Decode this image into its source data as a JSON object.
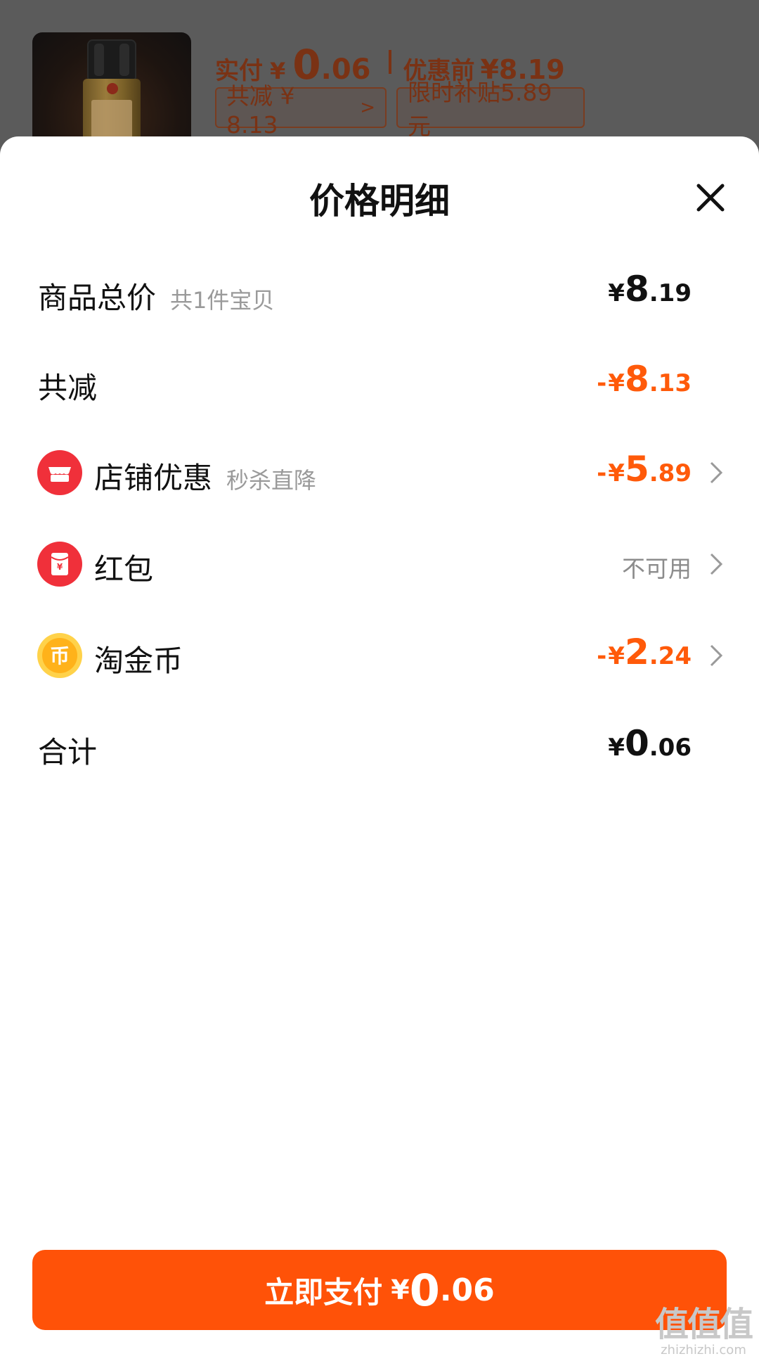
{
  "header": {
    "actual_pay_label": "实付",
    "actual_pay_currency": "¥",
    "actual_pay_int": "0",
    "actual_pay_dec": ".06",
    "before_discount_label": "优惠前",
    "before_discount_value": "¥8.19",
    "total_reduction_tag": "共减 ¥ 8.13",
    "subsidy_tag": "限时补贴5.89元"
  },
  "sheet": {
    "title": "价格明细",
    "rows": [
      {
        "label": "商品总价",
        "sub": "共1件宝贝",
        "sign": "",
        "currency": "¥",
        "int": "8",
        "dec": ".19"
      },
      {
        "label": "共减",
        "sub": "",
        "sign": "-",
        "currency": "¥",
        "int": "8",
        "dec": ".13"
      },
      {
        "label": "店铺优惠",
        "sub": "秒杀直降",
        "sign": "-",
        "currency": "¥",
        "int": "5",
        "dec": ".89",
        "icon": "store-icon"
      },
      {
        "label": "红包",
        "sub": "",
        "value_text": "不可用",
        "icon": "red-envelope-icon"
      },
      {
        "label": "淘金币",
        "sub": "",
        "sign": "-",
        "currency": "¥",
        "int": "2",
        "dec": ".24",
        "icon": "gold-coin-icon"
      },
      {
        "label": "合计",
        "sub": "",
        "sign": "",
        "currency": "¥",
        "int": "0",
        "dec": ".06"
      }
    ]
  },
  "pay_button": {
    "label": "立即支付",
    "currency": "¥",
    "int": "0",
    "dec": ".06"
  },
  "watermark": {
    "logo_text": "值值值",
    "domain": "zhizhizhi.com"
  },
  "colors": {
    "accent": "#ff5208",
    "discount": "#ff5a0a",
    "coin_icon": "#ffb21a",
    "red_icon": "#f0303a"
  }
}
